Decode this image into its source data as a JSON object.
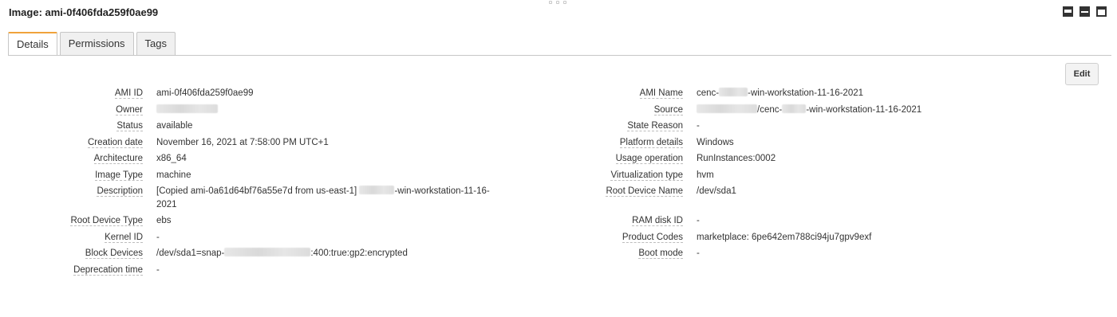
{
  "header": {
    "title": "Image: ami-0f406fda259f0ae99"
  },
  "tabs": [
    {
      "label": "Details"
    },
    {
      "label": "Permissions"
    },
    {
      "label": "Tags"
    }
  ],
  "actions": {
    "edit_label": "Edit"
  },
  "left_fields": [
    {
      "label": "AMI ID",
      "value": "ami-0f406fda259f0ae99"
    },
    {
      "label": "Owner",
      "value": ""
    },
    {
      "label": "Status",
      "value": "available"
    },
    {
      "label": "Creation date",
      "value": "November 16, 2021 at 7:58:00 PM UTC+1"
    },
    {
      "label": "Architecture",
      "value": "x86_64"
    },
    {
      "label": "Image Type",
      "value": "machine"
    },
    {
      "label": "Description",
      "value_prefix": "[Copied ami-0a61d64bf76a55e7d from us-east-1]",
      "value_suffix": "-win-workstation-11-16-2021"
    },
    {
      "label": "Root Device Type",
      "value": "ebs"
    },
    {
      "label": "Kernel ID",
      "value": "-"
    },
    {
      "label": "Block Devices",
      "value_prefix": "/dev/sda1=snap-",
      "value_suffix": ":400:true:gp2:encrypted"
    },
    {
      "label": "Deprecation time",
      "value": "-"
    }
  ],
  "right_fields": [
    {
      "label": "AMI Name",
      "value_prefix": "cenc-",
      "value_suffix": "-win-workstation-11-16-2021"
    },
    {
      "label": "Source",
      "value_prefix": "",
      "value_suffix": "/cenc-",
      "value_suffix2": "-win-workstation-11-16-2021"
    },
    {
      "label": "State Reason",
      "value": "-"
    },
    {
      "label": "Platform details",
      "value": "Windows"
    },
    {
      "label": "Usage operation",
      "value": "RunInstances:0002"
    },
    {
      "label": "Virtualization type",
      "value": "hvm"
    },
    {
      "label": "Root Device Name",
      "value": "/dev/sda1"
    },
    {
      "label": "RAM disk ID",
      "value": "-"
    },
    {
      "label": "Product Codes",
      "value": "marketplace: 6pe642em788ci94ju7gpv9exf"
    },
    {
      "label": "Boot mode",
      "value": "-"
    }
  ]
}
